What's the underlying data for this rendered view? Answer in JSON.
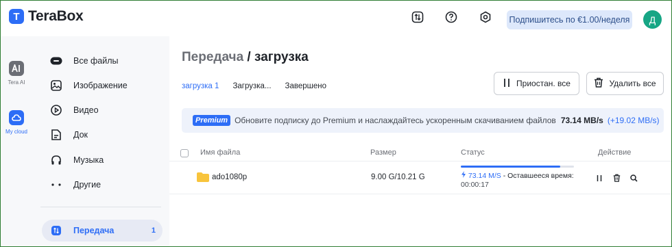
{
  "app": {
    "name": "TeraBox",
    "logo_glyph": "T"
  },
  "header": {
    "subscribe_label": "Подпишитесь по €1.00/неделя",
    "avatar_letter": "Д"
  },
  "rail": {
    "items": [
      {
        "label": "Tera AI",
        "icon": "ai-icon"
      },
      {
        "label": "My cloud",
        "icon": "cloud-icon"
      }
    ]
  },
  "sidebar": {
    "items": [
      {
        "label": "Все файлы",
        "icon": "all-files-icon"
      },
      {
        "label": "Изображение",
        "icon": "image-icon"
      },
      {
        "label": "Видео",
        "icon": "video-icon"
      },
      {
        "label": "Док",
        "icon": "document-icon"
      },
      {
        "label": "Музыка",
        "icon": "music-icon"
      },
      {
        "label": "Другие",
        "icon": "more-dots-icon"
      }
    ],
    "transfer": {
      "label": "Передача",
      "count": "1",
      "icon": "transfer-icon"
    }
  },
  "main": {
    "breadcrumb_parent": "Передача",
    "breadcrumb_sep": " / ",
    "breadcrumb_current": "загрузка",
    "tabs": [
      {
        "label": "загрузка 1"
      },
      {
        "label": "Загрузка..."
      },
      {
        "label": "Завершено"
      }
    ],
    "pause_all_label": "Приостан. все",
    "delete_all_label": "Удалить все"
  },
  "banner": {
    "badge": "Premium",
    "text": "Обновите подписку до Premium и наслаждайтесь ускоренным скачиванием файлов",
    "speed": "73.14 MB/s",
    "boost": "(+19.02 MB/s)"
  },
  "table": {
    "columns": [
      "Имя файла",
      "Размер",
      "Статус",
      "Действие"
    ],
    "rows": [
      {
        "name": "ado1080p",
        "size": "9.00 G/10.21 G",
        "progress": 0.88,
        "speed": "73.14 M/S",
        "remaining_label": " - Оставшееся время:",
        "remaining_time": "00:00:17"
      }
    ]
  },
  "colors": {
    "accent": "#2d6df6",
    "frame": "#2e7d32",
    "avatar": "#17a685",
    "folder": "#f8c43c"
  }
}
